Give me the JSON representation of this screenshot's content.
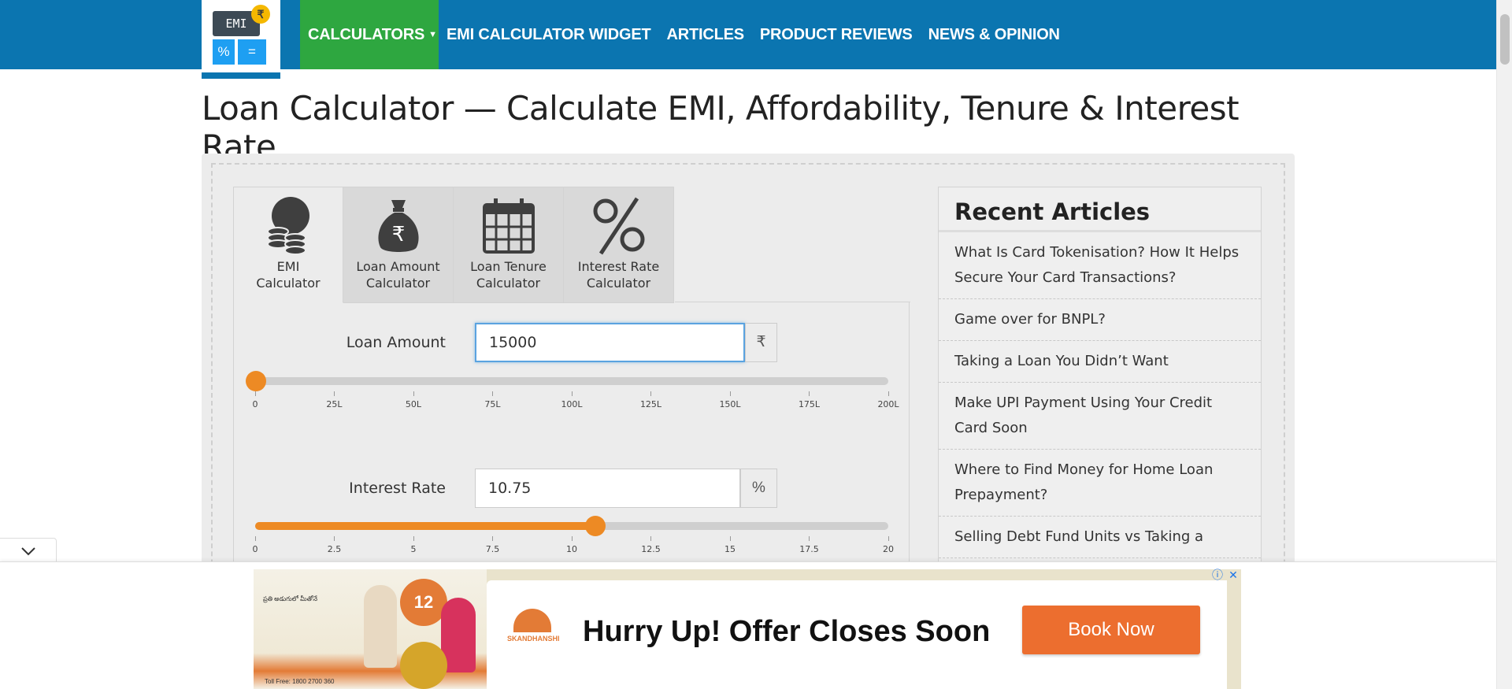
{
  "logo": {
    "screen_text": "EMI",
    "coin": "₹",
    "key_left": "%",
    "key_right": "="
  },
  "nav": {
    "items": [
      {
        "label": "CALCULATORS",
        "caret": "▼"
      },
      {
        "label": "EMI CALCULATOR WIDGET"
      },
      {
        "label": "ARTICLES"
      },
      {
        "label": "PRODUCT REVIEWS"
      },
      {
        "label": "NEWS & OPINION"
      }
    ]
  },
  "page": {
    "title": "Loan Calculator — Calculate EMI, Affordability, Tenure & Interest Rate"
  },
  "tabs": [
    {
      "line1": "EMI",
      "line2": "Calculator",
      "icon": "emi-coins-icon",
      "active": true
    },
    {
      "line1": "Loan Amount",
      "line2": "Calculator",
      "icon": "money-bag-icon",
      "active": false
    },
    {
      "line1": "Loan Tenure",
      "line2": "Calculator",
      "icon": "calendar-icon",
      "active": false
    },
    {
      "line1": "Interest Rate",
      "line2": "Calculator",
      "icon": "percent-icon",
      "active": false
    }
  ],
  "calculator": {
    "loan_amount": {
      "label": "Loan Amount",
      "value": "15000",
      "unit": "₹",
      "slider": {
        "min": 0,
        "max": 200,
        "value": 0.15,
        "ticks": [
          "0",
          "25L",
          "50L",
          "75L",
          "100L",
          "125L",
          "150L",
          "175L",
          "200L"
        ]
      }
    },
    "interest_rate": {
      "label": "Interest Rate",
      "value": "10.75",
      "unit": "%",
      "slider": {
        "min": 0,
        "max": 20,
        "value": 10.75,
        "ticks": [
          "0",
          "2.5",
          "5",
          "7.5",
          "10",
          "12.5",
          "15",
          "17.5",
          "20"
        ]
      }
    }
  },
  "sidebar": {
    "title": "Recent Articles",
    "articles": [
      "What Is Card Tokenisation? How It Helps Secure Your Card Transactions?",
      "Game over for BNPL?",
      "Taking a Loan You Didn’t Want",
      "Make UPI Payment Using Your Credit Card Soon",
      "Where to Find Money for Home Loan Prepayment?",
      "Selling Debt Fund Units vs Taking a"
    ]
  },
  "ad": {
    "left_text": "ప్రతి అడుగులో మీతోనే",
    "badge": "12",
    "brand": "SKANDHANSHI",
    "headline": "Hurry Up! Offer Closes Soon",
    "cta": "Book Now",
    "toll_free": "Toll Free: 1800 2700 360",
    "info_icon": "ⓘ",
    "close_icon": "✕"
  },
  "colors": {
    "nav_bg": "#0b75b0",
    "active_nav": "#2ea740",
    "slider": "#ed8a24",
    "cta": "#ec6e2f"
  }
}
